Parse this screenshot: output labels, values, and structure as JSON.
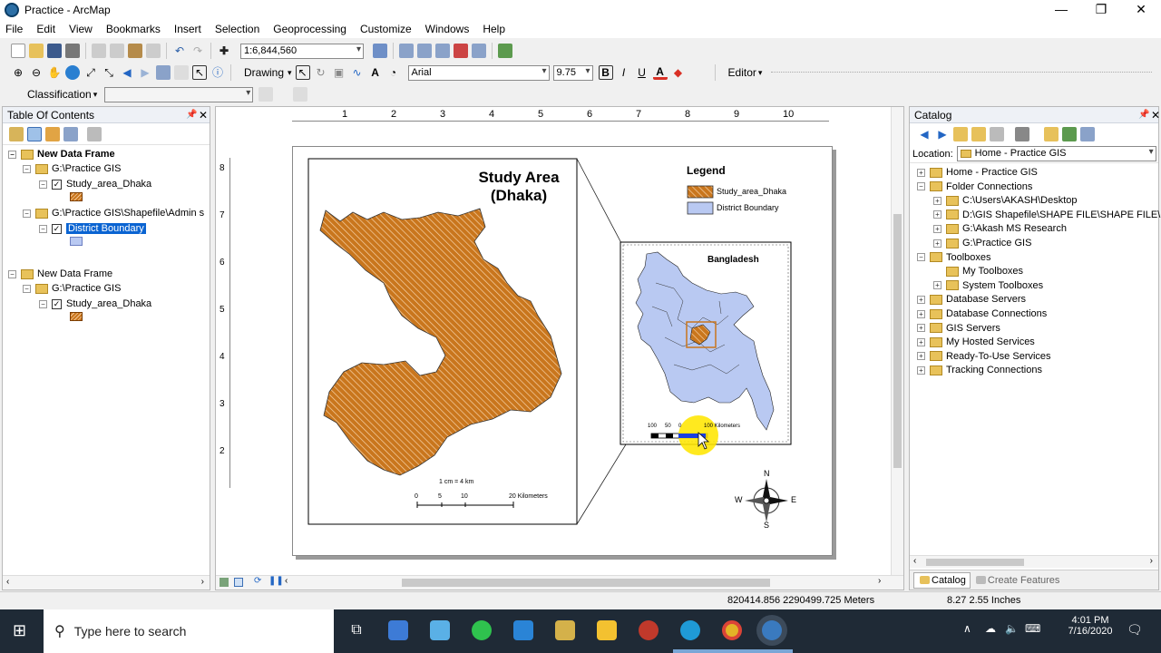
{
  "window": {
    "title": "Practice - ArcMap"
  },
  "menu": [
    "File",
    "Edit",
    "View",
    "Bookmarks",
    "Insert",
    "Selection",
    "Geoprocessing",
    "Customize",
    "Windows",
    "Help"
  ],
  "toolbar": {
    "scale": "1:6,844,560",
    "drawing_label": "Drawing",
    "font_name": "Arial",
    "font_size": "9.75",
    "bold": "B",
    "italic": "I",
    "underline": "U",
    "font_color_glyph": "A",
    "editor_label": "Editor",
    "classification_label": "Classification"
  },
  "toc": {
    "title": "Table Of Contents",
    "frames": [
      {
        "name": "New Data Frame",
        "groups": [
          {
            "path": "G:\\Practice GIS",
            "layers": [
              {
                "name": "Study_area_Dhaka"
              }
            ]
          },
          {
            "path": "G:\\Practice GIS\\Shapefile\\Admin s",
            "layers": [
              {
                "name": "District Boundary"
              }
            ]
          }
        ]
      },
      {
        "name": "New Data Frame",
        "groups": [
          {
            "path": "G:\\Practice GIS",
            "layers": [
              {
                "name": "Study_area_Dhaka"
              }
            ]
          }
        ]
      }
    ]
  },
  "ruler": {
    "h_ticks": [
      "1",
      "2",
      "3",
      "4",
      "5",
      "6",
      "7",
      "8",
      "9",
      "10"
    ],
    "v_ticks": [
      "8",
      "7",
      "6",
      "5",
      "4",
      "3",
      "2"
    ]
  },
  "layout": {
    "map_title_line1": "Study Area",
    "map_title_line2": "(Dhaka)",
    "main_scale_text": "1 cm = 4 km",
    "main_scale_labels": [
      "0",
      "5",
      "10",
      "20 Kilometers"
    ],
    "legend_title": "Legend",
    "legend_items": [
      "Study_area_Dhaka",
      "District Boundary"
    ],
    "inset_title": "Bangladesh",
    "inset_scale_labels": [
      "100",
      "50",
      "0",
      "100 Kilometers"
    ],
    "north": {
      "n": "N",
      "s": "S",
      "e": "E",
      "w": "W"
    }
  },
  "catalog": {
    "title": "Catalog",
    "location_label": "Location:",
    "location_value": "Home - Practice GIS",
    "items": [
      {
        "label": "Home - Practice GIS",
        "level": 0,
        "pm": "+"
      },
      {
        "label": "Folder Connections",
        "level": 0,
        "pm": "−"
      },
      {
        "label": "C:\\Users\\AKASH\\Desktop",
        "level": 1,
        "pm": "+"
      },
      {
        "label": "D:\\GIS Shapefile\\SHAPE FILE\\SHAPE FILE\\Fr",
        "level": 1,
        "pm": "+"
      },
      {
        "label": "G:\\Akash MS Research",
        "level": 1,
        "pm": "+"
      },
      {
        "label": "G:\\Practice GIS",
        "level": 1,
        "pm": "+"
      },
      {
        "label": "Toolboxes",
        "level": 0,
        "pm": "−"
      },
      {
        "label": "My Toolboxes",
        "level": 1,
        "pm": ""
      },
      {
        "label": "System Toolboxes",
        "level": 1,
        "pm": "+"
      },
      {
        "label": "Database Servers",
        "level": 0,
        "pm": "+"
      },
      {
        "label": "Database Connections",
        "level": 0,
        "pm": "+"
      },
      {
        "label": "GIS Servers",
        "level": 0,
        "pm": "+"
      },
      {
        "label": "My Hosted Services",
        "level": 0,
        "pm": "+"
      },
      {
        "label": "Ready-To-Use Services",
        "level": 0,
        "pm": "+"
      },
      {
        "label": "Tracking Connections",
        "level": 0,
        "pm": "+"
      }
    ],
    "tab_catalog": "Catalog",
    "tab_create": "Create Features"
  },
  "status": {
    "coords": "820414.856  2290499.725 Meters",
    "page_coords": "8.27  2.55 Inches"
  },
  "taskbar": {
    "search_placeholder": "Type here to search",
    "time": "4:01 PM",
    "date": "7/16/2020"
  }
}
